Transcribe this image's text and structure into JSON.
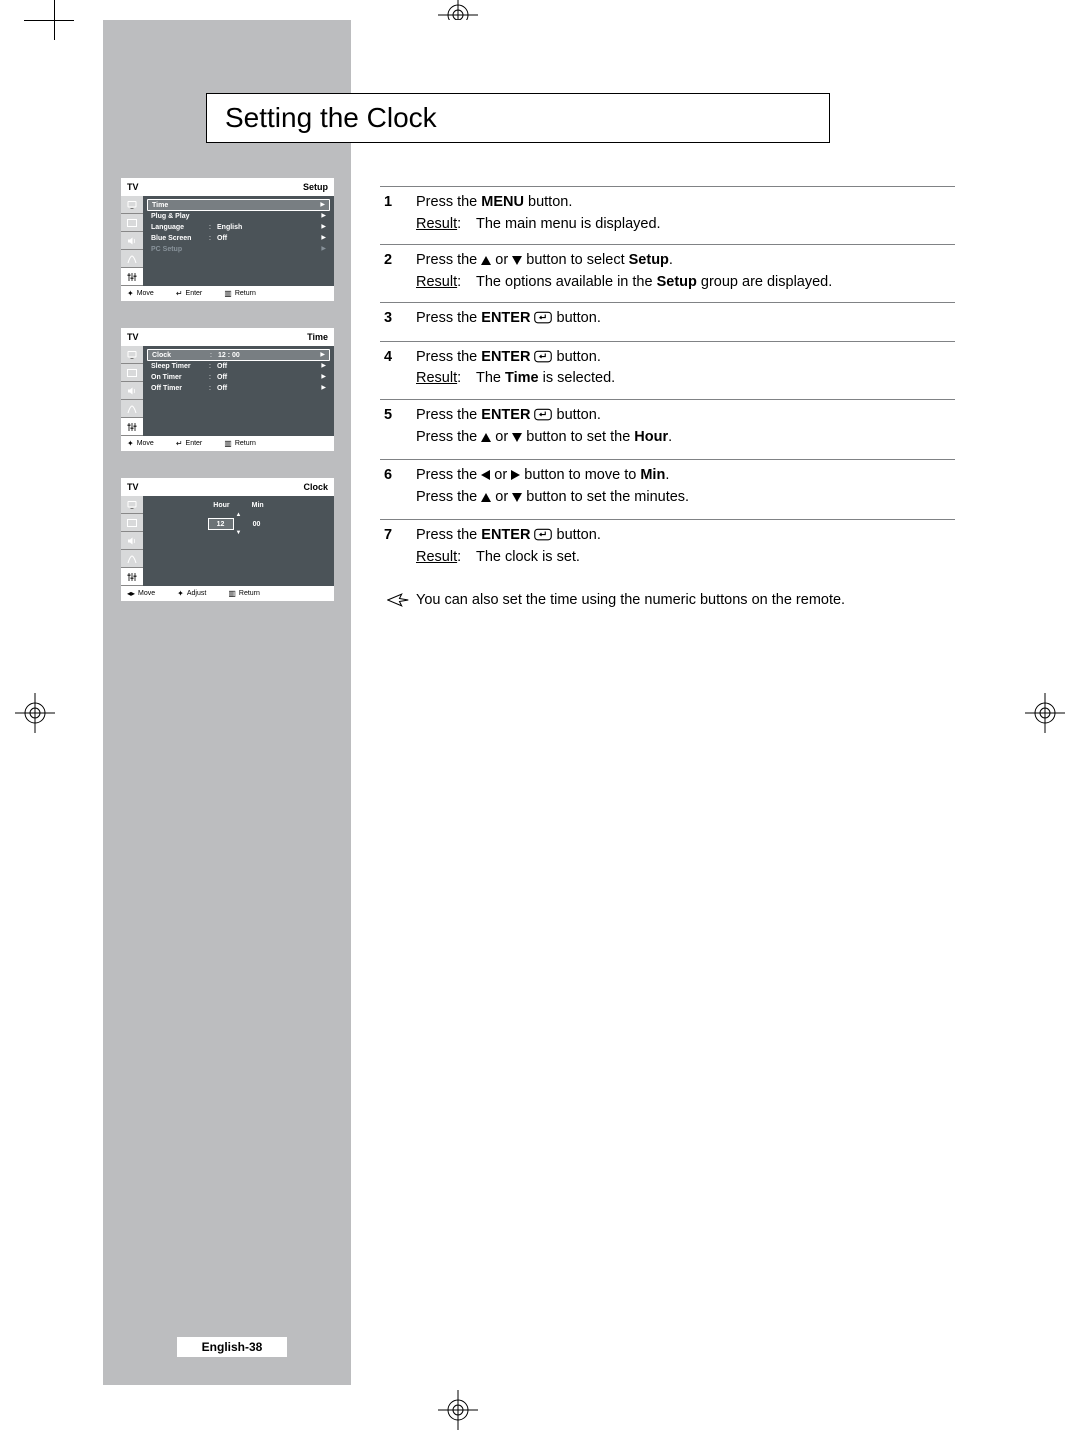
{
  "title": "Setting the Clock",
  "page_number": "English-38",
  "osd1": {
    "tv": "TV",
    "submenu": "Setup",
    "rows": [
      {
        "label": "Time",
        "colon": "",
        "value": "",
        "arrow": "▶",
        "selected": true
      },
      {
        "label": "Plug & Play",
        "colon": "",
        "value": "",
        "arrow": "▶"
      },
      {
        "label": "Language",
        "colon": ":",
        "value": "English",
        "arrow": "▶"
      },
      {
        "label": "Blue Screen",
        "colon": ":",
        "value": "Off",
        "arrow": "▶"
      },
      {
        "label": "PC Setup",
        "colon": "",
        "value": "",
        "arrow": "▶",
        "dim": true
      }
    ],
    "ftr": {
      "move": "Move",
      "enter": "Enter",
      "ret": "Return"
    }
  },
  "osd2": {
    "tv": "TV",
    "submenu": "Time",
    "rows": [
      {
        "label": "Clock",
        "colon": ":",
        "value": "12 : 00",
        "arrow": "▶",
        "selected": true
      },
      {
        "label": "Sleep Timer",
        "colon": ":",
        "value": "Off",
        "arrow": "▶"
      },
      {
        "label": "On Timer",
        "colon": ":",
        "value": "Off",
        "arrow": "▶"
      },
      {
        "label": "Off Timer",
        "colon": ":",
        "value": "Off",
        "arrow": "▶"
      }
    ],
    "ftr": {
      "move": "Move",
      "enter": "Enter",
      "ret": "Return"
    }
  },
  "osd3": {
    "tv": "TV",
    "submenu": "Clock",
    "labels": {
      "hour": "Hour",
      "min": "Min"
    },
    "values": {
      "hour": "12",
      "min": "00"
    },
    "ftr": {
      "move": "Move",
      "adjust": "Adjust",
      "ret": "Return"
    }
  },
  "steps": {
    "s1": {
      "num": "1",
      "l1a": "Press the ",
      "l1b": "MENU",
      "l1c": " button.",
      "res_lbl": "Result",
      "res_colon": ":",
      "res_txt": "The main menu is displayed."
    },
    "s2": {
      "num": "2",
      "l1a": "Press the ",
      "l1b": " or ",
      "l1c": " button to select ",
      "l1d": "Setup",
      "l1e": ".",
      "res_lbl": "Result",
      "res_colon": ":",
      "res_a": "The options available in the ",
      "res_b": "Setup",
      "res_c": " group are displayed."
    },
    "s3": {
      "num": "3",
      "l1a": "Press the ",
      "l1b": "ENTER",
      "l1c": " button."
    },
    "s4": {
      "num": "4",
      "l1a": "Press the ",
      "l1b": "ENTER",
      "l1c": " button.",
      "res_lbl": "Result",
      "res_colon": ":",
      "res_a": "The ",
      "res_b": "Time",
      "res_c": " is selected."
    },
    "s5": {
      "num": "5",
      "l1a": "Press the ",
      "l1b": "ENTER",
      "l1c": " button.",
      "l2a": "Press the ",
      "l2b": " or ",
      "l2c": " button to set the ",
      "l2d": "Hour",
      "l2e": "."
    },
    "s6": {
      "num": "6",
      "l1a": "Press the ",
      "l1b": " or ",
      "l1c": " button to move to ",
      "l1d": "Min",
      "l1e": ".",
      "l2a": "Press the ",
      "l2b": " or ",
      "l2c": " button to set the minutes."
    },
    "s7": {
      "num": "7",
      "l1a": "Press the ",
      "l1b": "ENTER",
      "l1c": " button.",
      "res_lbl": "Result",
      "res_colon": ":",
      "res_txt": "The clock is set."
    }
  },
  "note": "You can also set the time using the numeric buttons on the remote."
}
